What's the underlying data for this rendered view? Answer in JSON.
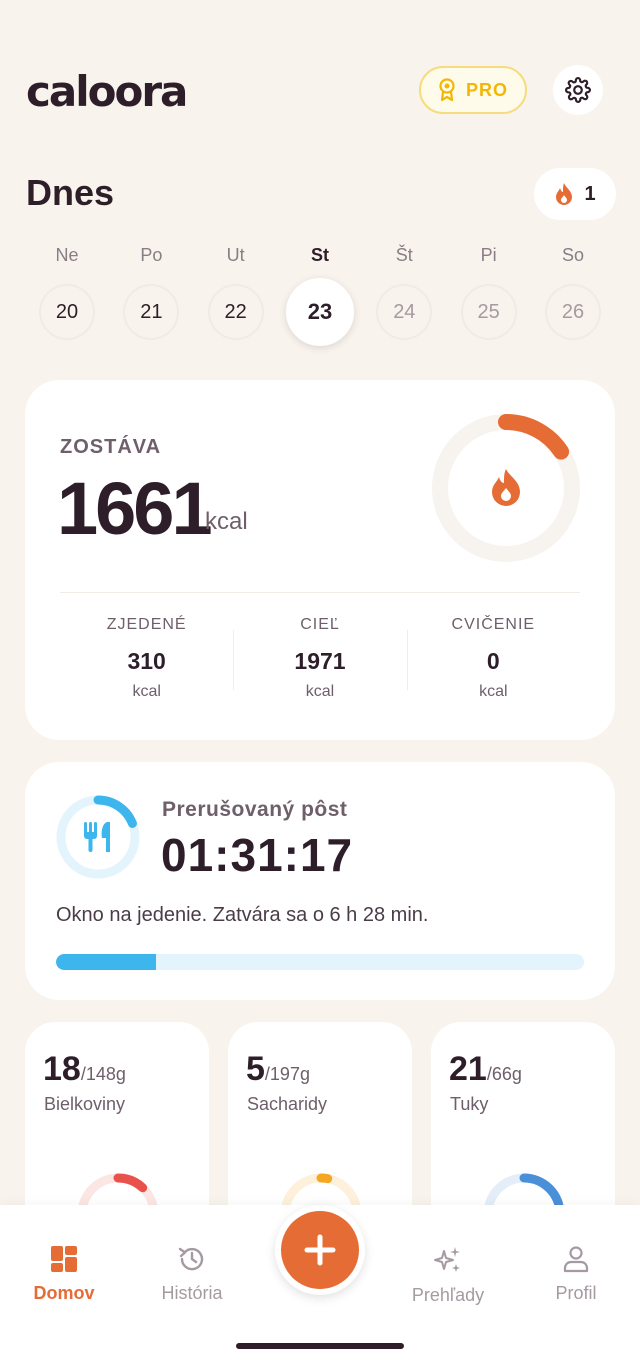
{
  "app": {
    "logo": "caloora",
    "pro_label": "PRO"
  },
  "header": {
    "title": "Dnes",
    "streak_count": "1"
  },
  "week": [
    {
      "name": "Ne",
      "date": "20"
    },
    {
      "name": "Po",
      "date": "21"
    },
    {
      "name": "Ut",
      "date": "22"
    },
    {
      "name": "St",
      "date": "23",
      "selected": true
    },
    {
      "name": "Št",
      "date": "24"
    },
    {
      "name": "Pi",
      "date": "25"
    },
    {
      "name": "So",
      "date": "26"
    }
  ],
  "calories": {
    "remaining_label": "ZOSTÁVA",
    "remaining_value": "1661",
    "remaining_unit": "kcal",
    "progress": 0.157,
    "eaten": {
      "label": "ZJEDENÉ",
      "value": "310",
      "unit": "kcal"
    },
    "goal": {
      "label": "CIEĽ",
      "value": "1971",
      "unit": "kcal"
    },
    "exercise": {
      "label": "CVIČENIE",
      "value": "0",
      "unit": "kcal"
    }
  },
  "fasting": {
    "title": "Prerušovaný pôst",
    "timer": "01:31:17",
    "status": "Okno na jedenie. Zatvára sa o 6 h 28 min.",
    "progress": 0.19
  },
  "macros": [
    {
      "value": "18",
      "goal": "/148g",
      "name": "Bielkoviny",
      "progress": 0.12,
      "color": "#e8524a"
    },
    {
      "value": "5",
      "goal": "/197g",
      "name": "Sacharidy",
      "progress": 0.03,
      "color": "#f5a623"
    },
    {
      "value": "21",
      "goal": "/66g",
      "name": "Tuky",
      "progress": 0.32,
      "color": "#4a90d9"
    }
  ],
  "nav": {
    "home": "Domov",
    "history": "História",
    "insights": "Prehľady",
    "profile": "Profil"
  },
  "colors": {
    "accent": "#e66c35",
    "fasting": "#3db5ed",
    "pro": "#f2b705",
    "background": "#f8f3ec"
  }
}
